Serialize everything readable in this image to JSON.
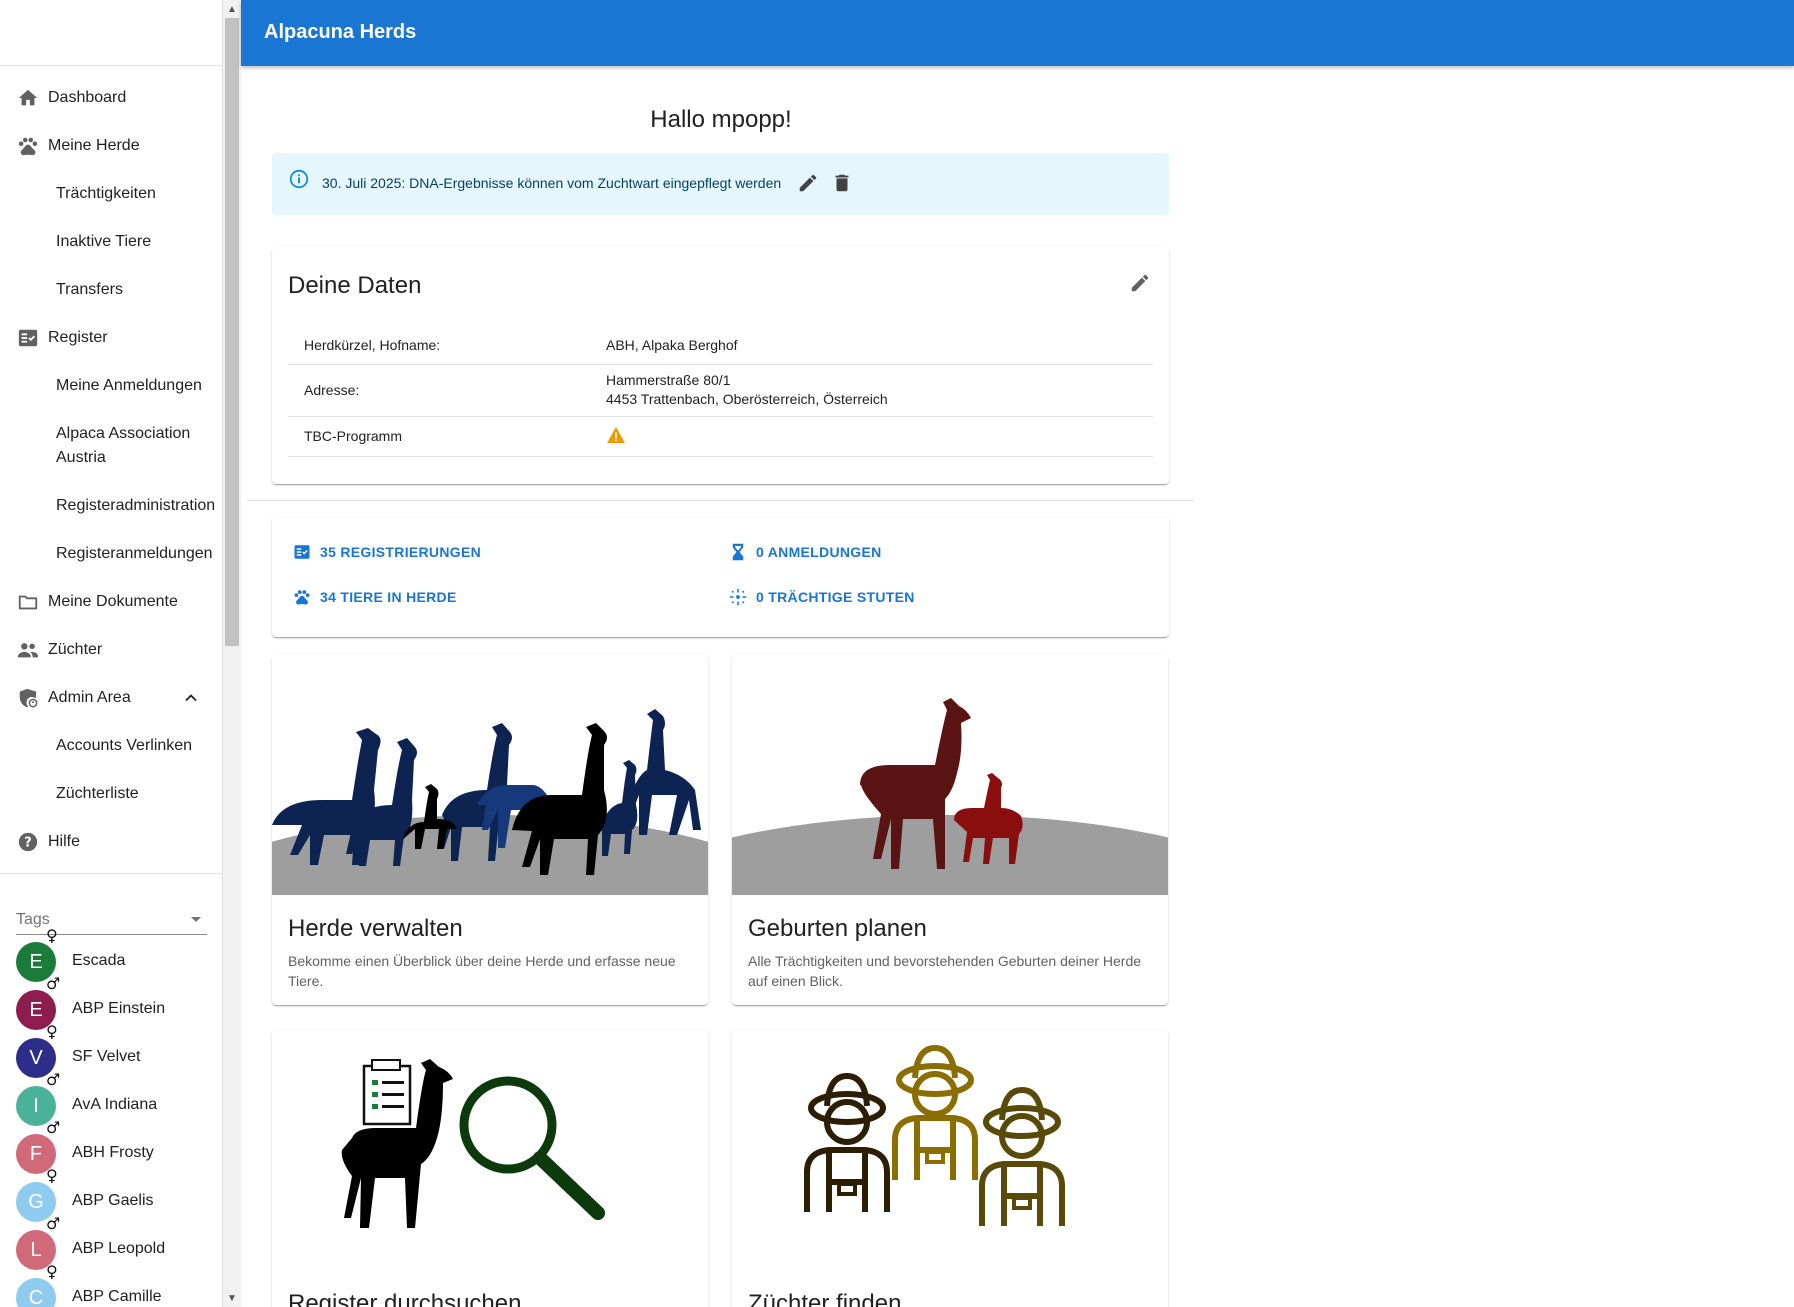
{
  "app": {
    "title": "Alpacuna Herds"
  },
  "sidebar": {
    "items": [
      {
        "label": "Dashboard",
        "icon": "home-icon"
      },
      {
        "label": "Meine Herde",
        "icon": "paw-icon"
      },
      {
        "label": "Trächtigkeiten"
      },
      {
        "label": "Inaktive Tiere"
      },
      {
        "label": "Transfers"
      },
      {
        "label": "Register",
        "icon": "register-icon"
      },
      {
        "label": "Meine Anmeldungen"
      },
      {
        "label": "Alpaca Association Austria"
      },
      {
        "label": "Registeradministration"
      },
      {
        "label": "Registeranmeldungen"
      },
      {
        "label": "Meine Dokumente",
        "icon": "folder-icon"
      },
      {
        "label": "Züchter",
        "icon": "people-icon"
      },
      {
        "label": "Admin Area",
        "icon": "admin-shield-icon"
      },
      {
        "label": "Accounts Verlinken"
      },
      {
        "label": "Züchterliste"
      },
      {
        "label": "Hilfe",
        "icon": "help-icon"
      }
    ],
    "tags_placeholder": "Tags",
    "animals": [
      {
        "initial": "E",
        "name": "Escada",
        "sex": "♀",
        "color": "#1b7c3a"
      },
      {
        "initial": "E",
        "name": "ABP Einstein",
        "sex": "♂",
        "color": "#8e1d4f"
      },
      {
        "initial": "V",
        "name": "SF Velvet",
        "sex": "♀",
        "color": "#2f2d8a"
      },
      {
        "initial": "I",
        "name": "AvA Indiana",
        "sex": "♂",
        "color": "#4bb29a"
      },
      {
        "initial": "F",
        "name": "ABH Frosty",
        "sex": "♂",
        "color": "#d0697a"
      },
      {
        "initial": "G",
        "name": "ABP Gaelis",
        "sex": "♀",
        "color": "#8ecbee"
      },
      {
        "initial": "L",
        "name": "ABP Leopold",
        "sex": "♂",
        "color": "#d0697a"
      },
      {
        "initial": "C",
        "name": "ABP Camille",
        "sex": "♀",
        "color": "#8ecbee"
      }
    ]
  },
  "main": {
    "greeting": "Hallo mpopp!",
    "alert": {
      "text": "30. Juli 2025: DNA-Ergebnisse können vom Zuchtwart eingepflegt werden"
    },
    "data_card": {
      "title": "Deine Daten",
      "rows": [
        {
          "key": "Herdkürzel, Hofname:",
          "value": "ABH, Alpaka Berghof"
        },
        {
          "key": "Adresse:",
          "value": "Hammerstraße 80/1",
          "value2": "4453 Trattenbach, Oberösterreich, Österreich"
        },
        {
          "key": "TBC-Programm",
          "value_icon": "warning-icon"
        }
      ]
    },
    "stats": {
      "registrierungen": "35 REGISTRIERUNGEN",
      "anmeldungen": "0 ANMELDUNGEN",
      "tiere": "34 TIERE IN HERDE",
      "traechtige": "0 TRÄCHTIGE STUTEN"
    },
    "features": [
      {
        "title": "Herde verwalten",
        "desc": "Bekomme einen Überblick über deine Herde und erfasse neue Tiere."
      },
      {
        "title": "Geburten planen",
        "desc": "Alle Trächtigkeiten und bevorstehenden Geburten deiner Herde auf einen Blick."
      },
      {
        "title": "Register durchsuchen",
        "desc": ""
      },
      {
        "title": "Züchter finden",
        "desc": ""
      }
    ]
  },
  "colors": {
    "primary": "#1976d2",
    "alert_bg": "#e5f6fd",
    "warning": "#ed9b00"
  }
}
